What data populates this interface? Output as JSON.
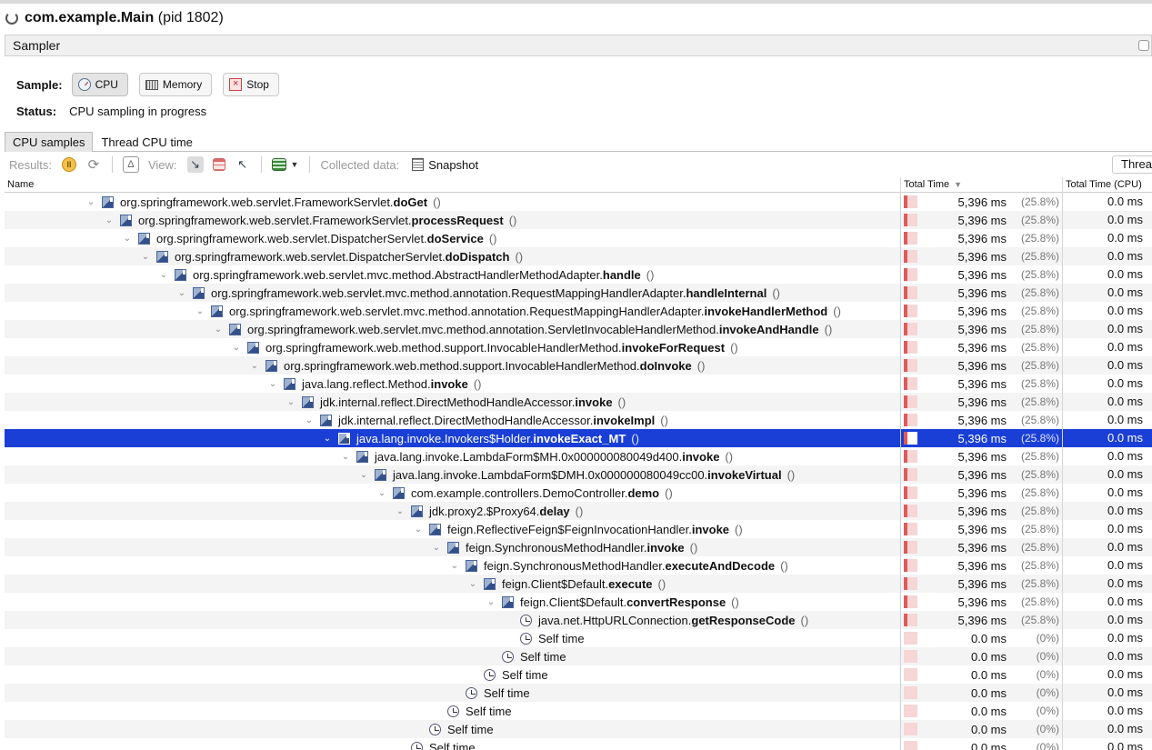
{
  "window": {
    "title_main": "com.example.Main",
    "title_pid": "(pid 1802)"
  },
  "sampler": {
    "label": "Sampler"
  },
  "sample": {
    "label": "Sample:",
    "buttons": {
      "cpu": "CPU",
      "memory": "Memory",
      "stop": "Stop"
    }
  },
  "status": {
    "label": "Status:",
    "text": "CPU sampling in progress"
  },
  "tabs": {
    "cpu_samples": "CPU samples",
    "thread_cpu_time": "Thread CPU time"
  },
  "toolbar": {
    "results_label": "Results:",
    "view_label": "View:",
    "collected_label": "Collected data:",
    "snapshot_label": "Snapshot",
    "threads_label": "Threa"
  },
  "table": {
    "headers": {
      "name": "Name",
      "total_time": "Total Time",
      "total_time_cpu": "Total Time (CPU)"
    },
    "rows": [
      {
        "depth": 0,
        "expand": true,
        "icon": "method",
        "cls": "org.springframework.web.servlet.FrameworkServlet.",
        "method": "doGet",
        "args": "()",
        "time": "5,396 ms",
        "pct": "(25.8%)",
        "fill": 0.258,
        "cpu": "0.0 ms"
      },
      {
        "depth": 1,
        "expand": true,
        "icon": "method",
        "cls": "org.springframework.web.servlet.FrameworkServlet.",
        "method": "processRequest",
        "args": "()",
        "time": "5,396 ms",
        "pct": "(25.8%)",
        "fill": 0.258,
        "cpu": "0.0 ms"
      },
      {
        "depth": 2,
        "expand": true,
        "icon": "method",
        "cls": "org.springframework.web.servlet.DispatcherServlet.",
        "method": "doService",
        "args": "()",
        "time": "5,396 ms",
        "pct": "(25.8%)",
        "fill": 0.258,
        "cpu": "0.0 ms"
      },
      {
        "depth": 3,
        "expand": true,
        "icon": "method",
        "cls": "org.springframework.web.servlet.DispatcherServlet.",
        "method": "doDispatch",
        "args": "()",
        "time": "5,396 ms",
        "pct": "(25.8%)",
        "fill": 0.258,
        "cpu": "0.0 ms"
      },
      {
        "depth": 4,
        "expand": true,
        "icon": "method",
        "cls": "org.springframework.web.servlet.mvc.method.AbstractHandlerMethodAdapter.",
        "method": "handle",
        "args": "()",
        "time": "5,396 ms",
        "pct": "(25.8%)",
        "fill": 0.258,
        "cpu": "0.0 ms"
      },
      {
        "depth": 5,
        "expand": true,
        "icon": "method",
        "cls": "org.springframework.web.servlet.mvc.method.annotation.RequestMappingHandlerAdapter.",
        "method": "handleInternal",
        "args": "()",
        "time": "5,396 ms",
        "pct": "(25.8%)",
        "fill": 0.258,
        "cpu": "0.0 ms"
      },
      {
        "depth": 6,
        "expand": true,
        "icon": "method",
        "cls": "org.springframework.web.servlet.mvc.method.annotation.RequestMappingHandlerAdapter.",
        "method": "invokeHandlerMethod",
        "args": "()",
        "time": "5,396 ms",
        "pct": "(25.8%)",
        "fill": 0.258,
        "cpu": "0.0 ms"
      },
      {
        "depth": 7,
        "expand": true,
        "icon": "method",
        "cls": "org.springframework.web.servlet.mvc.method.annotation.ServletInvocableHandlerMethod.",
        "method": "invokeAndHandle",
        "args": "()",
        "time": "5,396 ms",
        "pct": "(25.8%)",
        "fill": 0.258,
        "cpu": "0.0 ms"
      },
      {
        "depth": 8,
        "expand": true,
        "icon": "method",
        "cls": "org.springframework.web.method.support.InvocableHandlerMethod.",
        "method": "invokeForRequest",
        "args": "()",
        "time": "5,396 ms",
        "pct": "(25.8%)",
        "fill": 0.258,
        "cpu": "0.0 ms"
      },
      {
        "depth": 9,
        "expand": true,
        "icon": "method",
        "cls": "org.springframework.web.method.support.InvocableHandlerMethod.",
        "method": "doInvoke",
        "args": "()",
        "time": "5,396 ms",
        "pct": "(25.8%)",
        "fill": 0.258,
        "cpu": "0.0 ms"
      },
      {
        "depth": 10,
        "expand": true,
        "icon": "method",
        "cls": "java.lang.reflect.Method.",
        "method": "invoke",
        "args": "()",
        "time": "5,396 ms",
        "pct": "(25.8%)",
        "fill": 0.258,
        "cpu": "0.0 ms"
      },
      {
        "depth": 11,
        "expand": true,
        "icon": "method",
        "cls": "jdk.internal.reflect.DirectMethodHandleAccessor.",
        "method": "invoke",
        "args": "()",
        "time": "5,396 ms",
        "pct": "(25.8%)",
        "fill": 0.258,
        "cpu": "0.0 ms"
      },
      {
        "depth": 12,
        "expand": true,
        "icon": "method",
        "cls": "jdk.internal.reflect.DirectMethodHandleAccessor.",
        "method": "invokeImpl",
        "args": "()",
        "time": "5,396 ms",
        "pct": "(25.8%)",
        "fill": 0.258,
        "cpu": "0.0 ms"
      },
      {
        "depth": 13,
        "expand": true,
        "icon": "method",
        "cls": "java.lang.invoke.Invokers$Holder.",
        "method": "invokeExact_MT",
        "args": "()",
        "time": "5,396 ms",
        "pct": "(25.8%)",
        "fill": 0.258,
        "cpu": "0.0 ms",
        "selected": true
      },
      {
        "depth": 14,
        "expand": true,
        "icon": "method",
        "cls": "java.lang.invoke.LambdaForm$MH.0x000000080049d400.",
        "method": "invoke",
        "args": "()",
        "time": "5,396 ms",
        "pct": "(25.8%)",
        "fill": 0.258,
        "cpu": "0.0 ms"
      },
      {
        "depth": 15,
        "expand": true,
        "icon": "method",
        "cls": "java.lang.invoke.LambdaForm$DMH.0x000000080049cc00.",
        "method": "invokeVirtual",
        "args": "()",
        "time": "5,396 ms",
        "pct": "(25.8%)",
        "fill": 0.258,
        "cpu": "0.0 ms"
      },
      {
        "depth": 16,
        "expand": true,
        "icon": "method",
        "cls": "com.example.controllers.DemoController.",
        "method": "demo",
        "args": "()",
        "time": "5,396 ms",
        "pct": "(25.8%)",
        "fill": 0.258,
        "cpu": "0.0 ms"
      },
      {
        "depth": 17,
        "expand": true,
        "icon": "method",
        "cls": "jdk.proxy2.$Proxy64.",
        "method": "delay",
        "args": "()",
        "time": "5,396 ms",
        "pct": "(25.8%)",
        "fill": 0.258,
        "cpu": "0.0 ms"
      },
      {
        "depth": 18,
        "expand": true,
        "icon": "method",
        "cls": "feign.ReflectiveFeign$FeignInvocationHandler.",
        "method": "invoke",
        "args": "()",
        "time": "5,396 ms",
        "pct": "(25.8%)",
        "fill": 0.258,
        "cpu": "0.0 ms"
      },
      {
        "depth": 19,
        "expand": true,
        "icon": "method",
        "cls": "feign.SynchronousMethodHandler.",
        "method": "invoke",
        "args": "()",
        "time": "5,396 ms",
        "pct": "(25.8%)",
        "fill": 0.258,
        "cpu": "0.0 ms"
      },
      {
        "depth": 20,
        "expand": true,
        "icon": "method",
        "cls": "feign.SynchronousMethodHandler.",
        "method": "executeAndDecode",
        "args": "()",
        "time": "5,396 ms",
        "pct": "(25.8%)",
        "fill": 0.258,
        "cpu": "0.0 ms"
      },
      {
        "depth": 21,
        "expand": true,
        "icon": "method",
        "cls": "feign.Client$Default.",
        "method": "execute",
        "args": "()",
        "time": "5,396 ms",
        "pct": "(25.8%)",
        "fill": 0.258,
        "cpu": "0.0 ms"
      },
      {
        "depth": 22,
        "expand": true,
        "icon": "method",
        "cls": "feign.Client$Default.",
        "method": "convertResponse",
        "args": "()",
        "time": "5,396 ms",
        "pct": "(25.8%)",
        "fill": 0.258,
        "cpu": "0.0 ms"
      },
      {
        "depth": 23,
        "expand": false,
        "icon": "clock",
        "cls": "java.net.HttpURLConnection.",
        "method": "getResponseCode",
        "args": "()",
        "time": "5,396 ms",
        "pct": "(25.8%)",
        "fill": 0.258,
        "cpu": "0.0 ms"
      },
      {
        "depth": 23,
        "expand": false,
        "icon": "clock",
        "cls": "Self time",
        "method": "",
        "args": "",
        "time": "0.0 ms",
        "pct": "(0%)",
        "fill": 0,
        "cpu": "0.0 ms"
      },
      {
        "depth": 22,
        "expand": false,
        "icon": "clock",
        "cls": "Self time",
        "method": "",
        "args": "",
        "time": "0.0 ms",
        "pct": "(0%)",
        "fill": 0,
        "cpu": "0.0 ms"
      },
      {
        "depth": 21,
        "expand": false,
        "icon": "clock",
        "cls": "Self time",
        "method": "",
        "args": "",
        "time": "0.0 ms",
        "pct": "(0%)",
        "fill": 0,
        "cpu": "0.0 ms"
      },
      {
        "depth": 20,
        "expand": false,
        "icon": "clock",
        "cls": "Self time",
        "method": "",
        "args": "",
        "time": "0.0 ms",
        "pct": "(0%)",
        "fill": 0,
        "cpu": "0.0 ms"
      },
      {
        "depth": 19,
        "expand": false,
        "icon": "clock",
        "cls": "Self time",
        "method": "",
        "args": "",
        "time": "0.0 ms",
        "pct": "(0%)",
        "fill": 0,
        "cpu": "0.0 ms"
      },
      {
        "depth": 18,
        "expand": false,
        "icon": "clock",
        "cls": "Self time",
        "method": "",
        "args": "",
        "time": "0.0 ms",
        "pct": "(0%)",
        "fill": 0,
        "cpu": "0.0 ms"
      },
      {
        "depth": 17,
        "expand": false,
        "icon": "clock",
        "cls": "Self time",
        "method": "",
        "args": "",
        "time": "0.0 ms",
        "pct": "(0%)",
        "fill": 0,
        "cpu": "0.0 ms"
      }
    ]
  },
  "colors": {
    "selection": "#1a3fd6",
    "bar_fill": "#e05a5a",
    "bar_bg": "#f7d6d6"
  },
  "icons": [
    "spinner-icon",
    "cpu-icon",
    "memory-icon",
    "stop-icon",
    "pause-icon",
    "refresh-icon",
    "delta-icon",
    "call-tree-icon",
    "hot-spots-icon",
    "back-trace-icon",
    "color-icon",
    "snapshot-icon",
    "method-icon",
    "clock-icon"
  ]
}
